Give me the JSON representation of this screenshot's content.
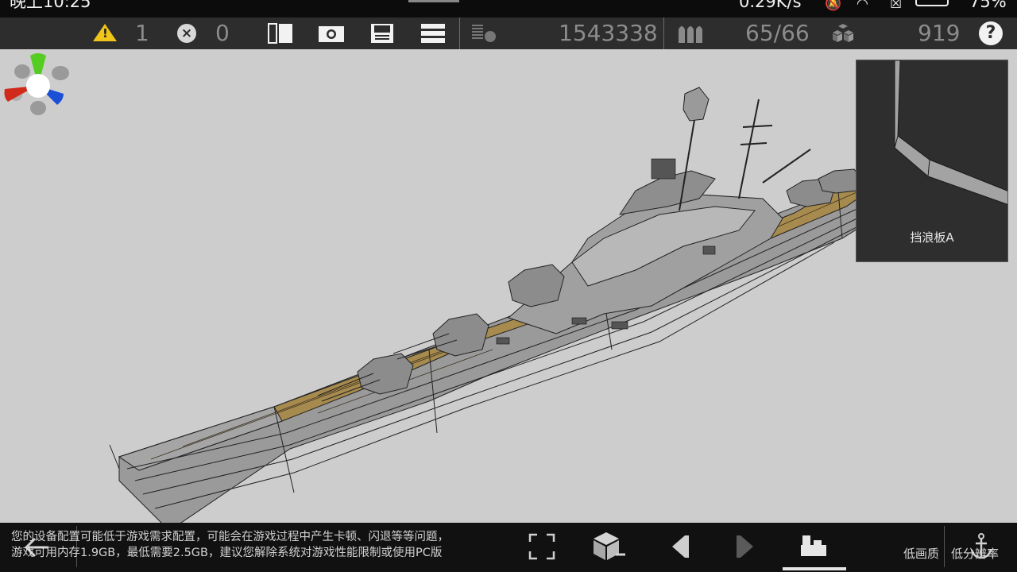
{
  "status_bar": {
    "time": "晚上10:25",
    "network_speed": "0.29K/s",
    "battery_percent": "75%"
  },
  "toolbar": {
    "warning_count": "1",
    "error_count": "0",
    "triangle_count": "1543338",
    "parts_count": "65/66",
    "weight_value": "919"
  },
  "viewport": {
    "colors": {
      "background": "#cdcdcd",
      "hull": "#9c9c9c",
      "deck": "#a78a4d",
      "axis_x": "#d22a1a",
      "axis_y": "#55cc22",
      "axis_z": "#1a4fd6"
    }
  },
  "preview": {
    "part_name": "挡浪板A"
  },
  "bottom_bar": {
    "notice_line1": "您的设备配置可能低于游戏需求配置，可能会在游戏过程中产生卡顿、闪退等等问题，",
    "notice_line2": "游戏可用内存1.9GB，最低需要2.5GB，建议您解除系统对游戏性能限制或使用PC版",
    "low_quality_label": "低画质",
    "low_fps_label": "低分辨率"
  }
}
